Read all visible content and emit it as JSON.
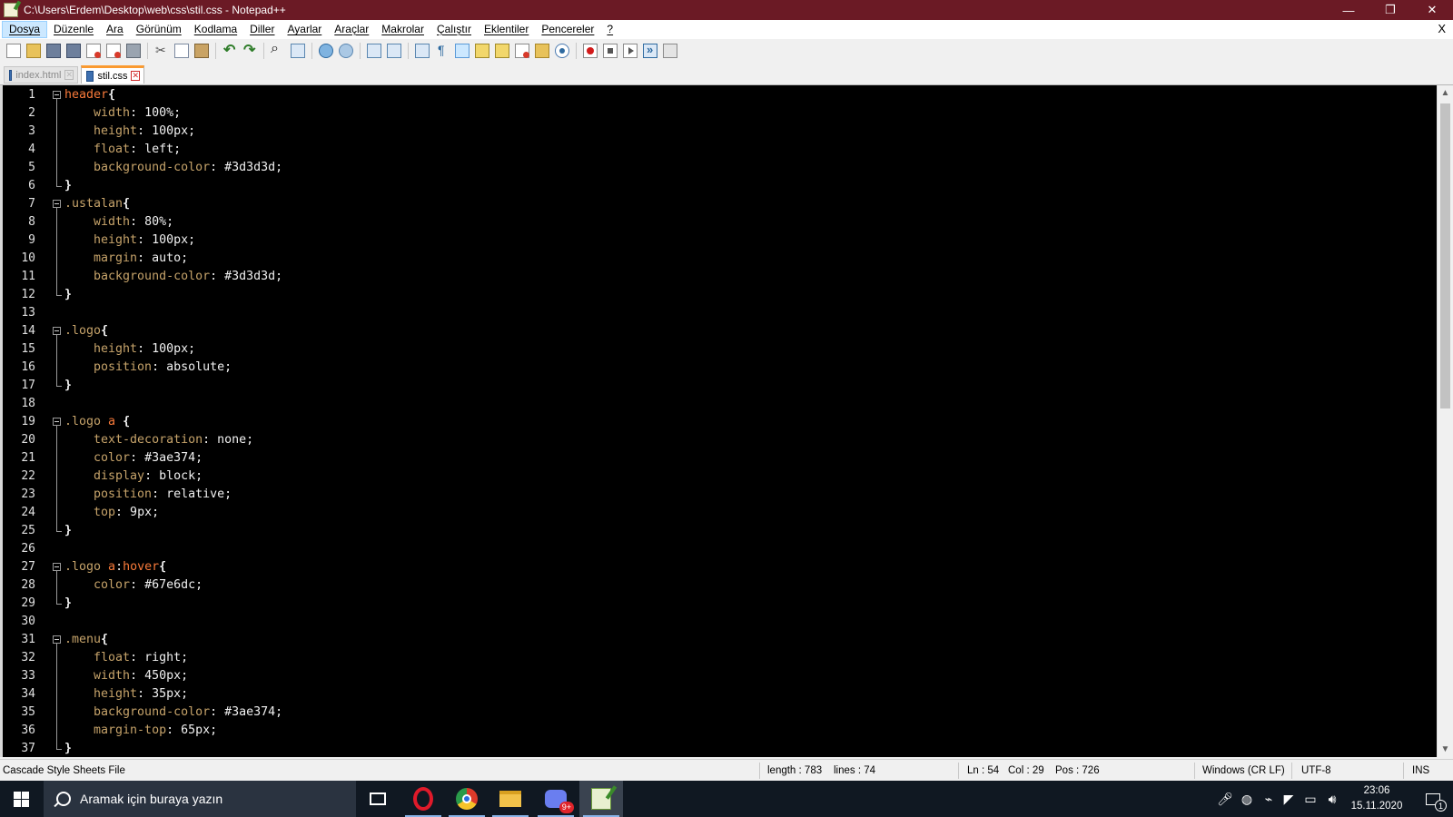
{
  "window": {
    "title": "C:\\Users\\Erdem\\Desktop\\web\\css\\stil.css - Notepad++",
    "minimize": "—",
    "restore": "❐",
    "close": "✕"
  },
  "menu": {
    "items": [
      "Dosya",
      "Düzenle",
      "Ara",
      "Görünüm",
      "Kodlama",
      "Diller",
      "Ayarlar",
      "Araçlar",
      "Makrolar",
      "Çalıştır",
      "Eklentiler",
      "Pencereler",
      "?"
    ],
    "close_doc": "X"
  },
  "tabs": [
    {
      "label": "index.html",
      "active": false
    },
    {
      "label": "stil.css",
      "active": true
    }
  ],
  "editor": {
    "lines": [
      {
        "n": "1",
        "tokens": [
          [
            "sel",
            "header"
          ],
          [
            "brace",
            "{"
          ]
        ]
      },
      {
        "n": "2",
        "tokens": [
          [
            "prop",
            "    width"
          ],
          [
            "val",
            ": 100%;"
          ]
        ]
      },
      {
        "n": "3",
        "tokens": [
          [
            "prop",
            "    height"
          ],
          [
            "val",
            ": 100px;"
          ]
        ]
      },
      {
        "n": "4",
        "tokens": [
          [
            "prop",
            "    float"
          ],
          [
            "val",
            ": left;"
          ]
        ]
      },
      {
        "n": "5",
        "tokens": [
          [
            "prop",
            "    background-color"
          ],
          [
            "val",
            ": #3d3d3d;"
          ]
        ]
      },
      {
        "n": "6",
        "tokens": [
          [
            "brace",
            "}"
          ]
        ]
      },
      {
        "n": "7",
        "tokens": [
          [
            "prop",
            ".ustalan"
          ],
          [
            "brace",
            "{"
          ]
        ]
      },
      {
        "n": "8",
        "tokens": [
          [
            "prop",
            "    width"
          ],
          [
            "val",
            ": 80%;"
          ]
        ]
      },
      {
        "n": "9",
        "tokens": [
          [
            "prop",
            "    height"
          ],
          [
            "val",
            ": 100px;"
          ]
        ]
      },
      {
        "n": "10",
        "tokens": [
          [
            "prop",
            "    margin"
          ],
          [
            "val",
            ": auto;"
          ]
        ]
      },
      {
        "n": "11",
        "tokens": [
          [
            "prop",
            "    background-color"
          ],
          [
            "val",
            ": #3d3d3d;"
          ]
        ]
      },
      {
        "n": "12",
        "tokens": [
          [
            "brace",
            "}"
          ]
        ]
      },
      {
        "n": "13",
        "tokens": []
      },
      {
        "n": "14",
        "tokens": [
          [
            "prop",
            ".logo"
          ],
          [
            "brace",
            "{"
          ]
        ]
      },
      {
        "n": "15",
        "tokens": [
          [
            "prop",
            "    height"
          ],
          [
            "val",
            ": 100px;"
          ]
        ]
      },
      {
        "n": "16",
        "tokens": [
          [
            "prop",
            "    position"
          ],
          [
            "val",
            ": absolute;"
          ]
        ]
      },
      {
        "n": "17",
        "tokens": [
          [
            "brace",
            "}"
          ]
        ]
      },
      {
        "n": "18",
        "tokens": []
      },
      {
        "n": "19",
        "tokens": [
          [
            "prop",
            ".logo "
          ],
          [
            "sel",
            "a"
          ],
          [
            "brace",
            " {"
          ]
        ]
      },
      {
        "n": "20",
        "tokens": [
          [
            "prop",
            "    text-decoration"
          ],
          [
            "val",
            ": none;"
          ]
        ]
      },
      {
        "n": "21",
        "tokens": [
          [
            "prop",
            "    color"
          ],
          [
            "val",
            ": #3ae374;"
          ]
        ]
      },
      {
        "n": "22",
        "tokens": [
          [
            "prop",
            "    display"
          ],
          [
            "val",
            ": block;"
          ]
        ]
      },
      {
        "n": "23",
        "tokens": [
          [
            "prop",
            "    position"
          ],
          [
            "val",
            ": relative;"
          ]
        ]
      },
      {
        "n": "24",
        "tokens": [
          [
            "prop",
            "    top"
          ],
          [
            "val",
            ": 9px;"
          ]
        ]
      },
      {
        "n": "25",
        "tokens": [
          [
            "brace",
            "}"
          ]
        ]
      },
      {
        "n": "26",
        "tokens": []
      },
      {
        "n": "27",
        "tokens": [
          [
            "prop",
            ".logo "
          ],
          [
            "sel",
            "a"
          ],
          [
            "val",
            ":"
          ],
          [
            "sel",
            "hover"
          ],
          [
            "brace",
            "{"
          ]
        ]
      },
      {
        "n": "28",
        "tokens": [
          [
            "prop",
            "    color"
          ],
          [
            "val",
            ": #67e6dc;"
          ]
        ]
      },
      {
        "n": "29",
        "tokens": [
          [
            "brace",
            "}"
          ]
        ]
      },
      {
        "n": "30",
        "tokens": []
      },
      {
        "n": "31",
        "tokens": [
          [
            "prop",
            ".menu"
          ],
          [
            "brace",
            "{"
          ]
        ]
      },
      {
        "n": "32",
        "tokens": [
          [
            "prop",
            "    float"
          ],
          [
            "val",
            ": right;"
          ]
        ]
      },
      {
        "n": "33",
        "tokens": [
          [
            "prop",
            "    width"
          ],
          [
            "val",
            ": 450px;"
          ]
        ]
      },
      {
        "n": "34",
        "tokens": [
          [
            "prop",
            "    height"
          ],
          [
            "val",
            ": 35px;"
          ]
        ]
      },
      {
        "n": "35",
        "tokens": [
          [
            "prop",
            "    background-color"
          ],
          [
            "val",
            ": #3ae374;"
          ]
        ]
      },
      {
        "n": "36",
        "tokens": [
          [
            "prop",
            "    margin-top"
          ],
          [
            "val",
            ": 65px;"
          ]
        ]
      },
      {
        "n": "37",
        "tokens": [
          [
            "brace",
            "}"
          ]
        ]
      }
    ]
  },
  "status": {
    "file_type": "Cascade Style Sheets File",
    "length": "length : 783",
    "lines": "lines : 74",
    "ln": "Ln : 54",
    "col": "Col : 29",
    "pos": "Pos : 726",
    "eol": "Windows (CR LF)",
    "encoding": "UTF-8",
    "mode": "INS"
  },
  "taskbar": {
    "search_placeholder": "Aramak için buraya yazın",
    "discord_badge": "9+",
    "time": "23:06",
    "date": "15.11.2020",
    "notifications": "1"
  }
}
